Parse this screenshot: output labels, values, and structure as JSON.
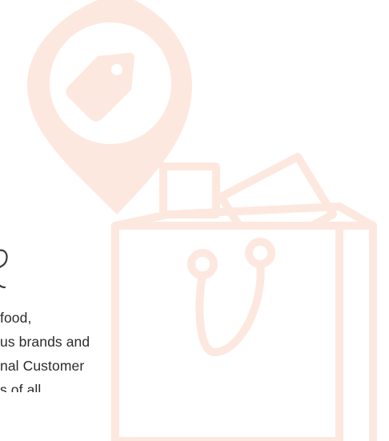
{
  "illustration": {
    "pin_icon": "price-tag-location-pin-icon",
    "bag_icon": "shopping-bag-icon",
    "accent_color": "#fde8df"
  },
  "body_text": {
    "lines": [
      "food,",
      "us brands and",
      "nal Customer",
      "s of all"
    ]
  }
}
